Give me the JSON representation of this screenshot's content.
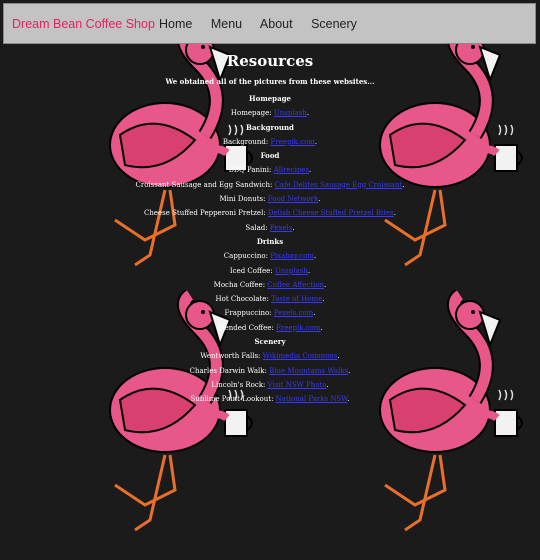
{
  "nav": {
    "brand": "Dream Bean Coffee Shop",
    "links": [
      "Home",
      "Menu",
      "About",
      "Scenery"
    ]
  },
  "page": {
    "title": "Resources",
    "intro": "We obtained all of the pictures from these websites...",
    "sections": [
      {
        "heading": "Homepage",
        "items": [
          {
            "label": "Homepage:",
            "link": "Unsplash"
          }
        ]
      },
      {
        "heading": "Background",
        "items": [
          {
            "label": "Background:",
            "link": "Freepik.com"
          }
        ]
      },
      {
        "heading": "Food",
        "items": [
          {
            "label": "BBQ Panini:",
            "link": "Allrecipes"
          },
          {
            "label": "Croissant Sausage and Egg Sandwich:",
            "link": "Cafe Delites Sausage Egg Croissant"
          },
          {
            "label": "Mini Donuts:",
            "link": "Food Network"
          },
          {
            "label": "Cheese Stuffed Pepperoni Pretzel:",
            "link": "Delish Cheese Stuffed Pretzel Bites"
          },
          {
            "label": "Salad:",
            "link": "Pexels"
          }
        ]
      },
      {
        "heading": "Drinks",
        "items": [
          {
            "label": "Cappuccino:",
            "link": "Pixabay.com"
          },
          {
            "label": "Iced Coffee:",
            "link": "Unsplash"
          },
          {
            "label": "Mocha Coffee:",
            "link": "Coffee Affection"
          },
          {
            "label": "Hot Chocolate:",
            "link": "Taste of Home"
          },
          {
            "label": "Frappuccino:",
            "link": "Pexels.com"
          },
          {
            "label": "Blended Coffee:",
            "link": "Freepik.com"
          }
        ]
      },
      {
        "heading": "Scenery",
        "items": [
          {
            "label": "Wentworth Falls:",
            "link": "Wikimedia Commons"
          },
          {
            "label": "Charles Darwin Walk:",
            "link": "Blue Mountains Walks"
          },
          {
            "label": "Lincoln's Rock:",
            "link": "Visit NSW Photo"
          },
          {
            "label": "Sublime Point Lookout:",
            "link": "National Parks NSW"
          }
        ]
      }
    ]
  },
  "colors": {
    "background": "#1b1b1b",
    "nav_bg": "#c3c3c3",
    "brand": "#e0245e",
    "link": "#3838ff",
    "flamingo": "#e8578a"
  }
}
